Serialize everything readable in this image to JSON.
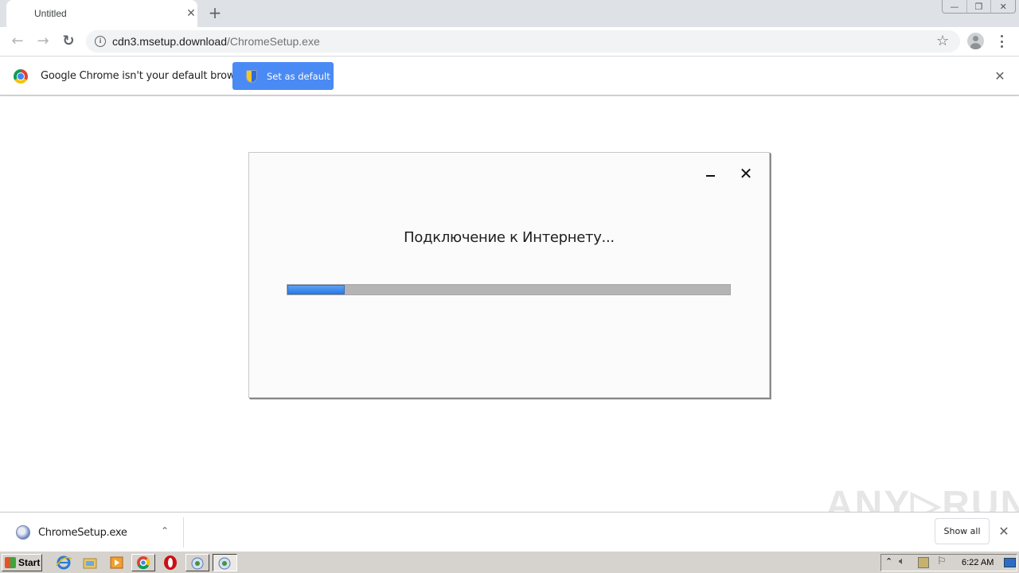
{
  "browser": {
    "tab": {
      "title": "Untitled",
      "close_glyph": "✕"
    },
    "new_tab_glyph": "+",
    "window_controls": {
      "minimize": "—",
      "restore": "❐",
      "close": "✕"
    },
    "toolbar": {
      "back_glyph": "←",
      "forward_glyph": "→",
      "reload_glyph": "↻",
      "url_host": "cdn3.msetup.download",
      "url_path": "/ChromeSetup.exe",
      "info_glyph": "i",
      "star_glyph": "☆"
    },
    "infobar": {
      "message": "Google Chrome isn't your default browser",
      "button_label": "Set as default",
      "close_glyph": "✕"
    }
  },
  "installer_dialog": {
    "minimize_glyph": "",
    "close_glyph": "✕",
    "status": "Подключение к Интернету...",
    "progress_percent": 13,
    "progress_color": "#3a86ee"
  },
  "download_shelf": {
    "file_name": "ChromeSetup.exe",
    "chevron_glyph": "⌃",
    "show_all_label": "Show all",
    "close_glyph": "✕"
  },
  "watermark": "ANY▷RUN",
  "taskbar": {
    "start_label": "Start",
    "pinned": [
      "internet-explorer",
      "file-explorer",
      "media-player",
      "chrome",
      "opera",
      "chromesetup",
      "chromesetup-active"
    ],
    "tray_icons": [
      "show-hidden-chevron",
      "volume",
      "network-warning",
      "action-center-flag"
    ],
    "clock": "6:22 AM"
  }
}
